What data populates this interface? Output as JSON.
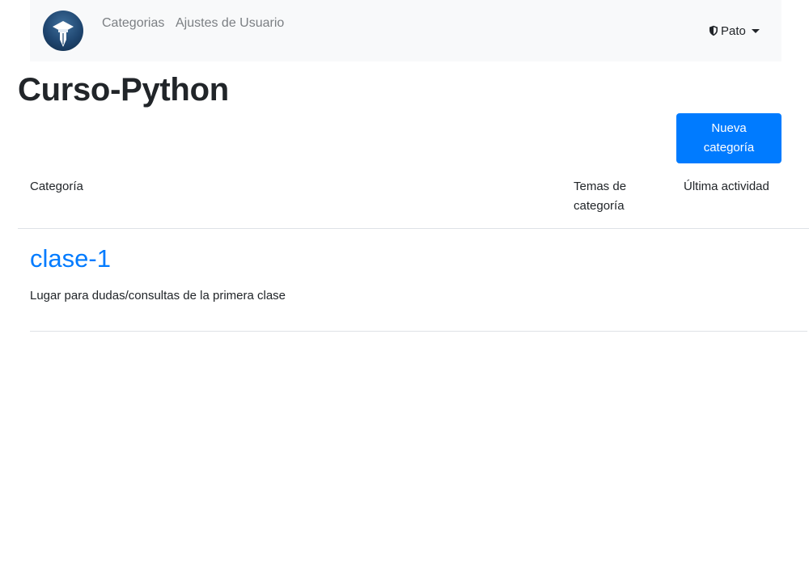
{
  "navbar": {
    "logo_icon": "graduation-pen-logo",
    "links": [
      "Categorias",
      "Ajustes de Usuario"
    ],
    "user": {
      "icon": "shield-icon",
      "name": "Pato",
      "caret_icon": "caret-down-icon"
    }
  },
  "page": {
    "title": "Curso-Python",
    "new_button_label": "Nueva categoría"
  },
  "table": {
    "headers": {
      "category": "Categoría",
      "topics": "Temas de categoría",
      "last_activity": "Última actividad"
    },
    "rows": [
      {
        "name": "clase-1",
        "description": "Lugar para dudas/consultas de la primera clase",
        "topics": "",
        "last_activity": ""
      }
    ]
  },
  "colors": {
    "primary": "#007bff",
    "navbar_bg": "#f8f9fa",
    "nav_link": "#7b7f83",
    "rule": "#dee2e6"
  }
}
